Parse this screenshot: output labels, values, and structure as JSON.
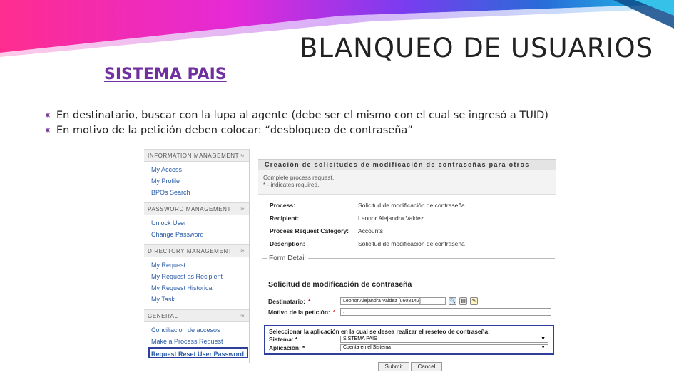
{
  "slide": {
    "title": "BLANQUEO DE USUARIOS",
    "subtitle": "SISTEMA PAIS",
    "bullets": [
      "En destinatario, buscar con la lupa al agente (debe ser el mismo con el cual se ingresó a TUID)",
      "En motivo de la petición deben colocar: “desbloqueo de contraseña”"
    ],
    "colors": {
      "accent": "#7030a0",
      "highlight_border": "#2e3f9b"
    }
  },
  "sidebar": {
    "sections": [
      {
        "header": "INFORMATION MANAGEMENT",
        "items": [
          "My Access",
          "My Profile",
          "BPOs Search"
        ]
      },
      {
        "header": "PASSWORD MANAGEMENT",
        "items": [
          "Unlock User",
          "Change Password"
        ]
      },
      {
        "header": "DIRECTORY MANAGEMENT",
        "items": [
          "My Request",
          "My Request as Recipient",
          "My Request Historical",
          "My Task"
        ]
      },
      {
        "header": "GENERAL",
        "items": [
          "Conciliacion de accesos",
          "Make a Process Request",
          "Request Reset User Password"
        ]
      }
    ],
    "collapse_icon": "chevron-up-double-icon"
  },
  "main": {
    "header": "Creación de solicitudes de modificación de contraseñas para otros",
    "info_line1": "Complete process request.",
    "info_line2": "* - indicates required.",
    "details": [
      {
        "label": "Process:",
        "value": "Solicitud de modificación de contraseña"
      },
      {
        "label": "Recipient:",
        "value": "Leonor Alejandra Valdez"
      },
      {
        "label": "Process Request Category:",
        "value": "Accounts"
      },
      {
        "label": "Description:",
        "value": "Solicitud de modificación de contraseña"
      }
    ],
    "form_detail_legend": "Form Detail",
    "form_title": "Solicitud de modificación de contraseña",
    "destinatario_label": "Destinatario:",
    "destinatario_value": "Leonor Alejandra Valdez [u608142]",
    "motivo_label": "Motivo de la petición:",
    "motivo_value": ".",
    "required_mark": "*",
    "app_box_title": "Seleccionar la aplicación en la cual se desea realizar el reseteo de contraseña:",
    "sistema_label": "Sistema:",
    "sistema_value": "SISTEMA PAIS",
    "aplicacion_label": "Aplicación:",
    "aplicacion_value": "Cuenta en el Sistema",
    "submit_label": "Submit",
    "cancel_label": "Cancel"
  }
}
